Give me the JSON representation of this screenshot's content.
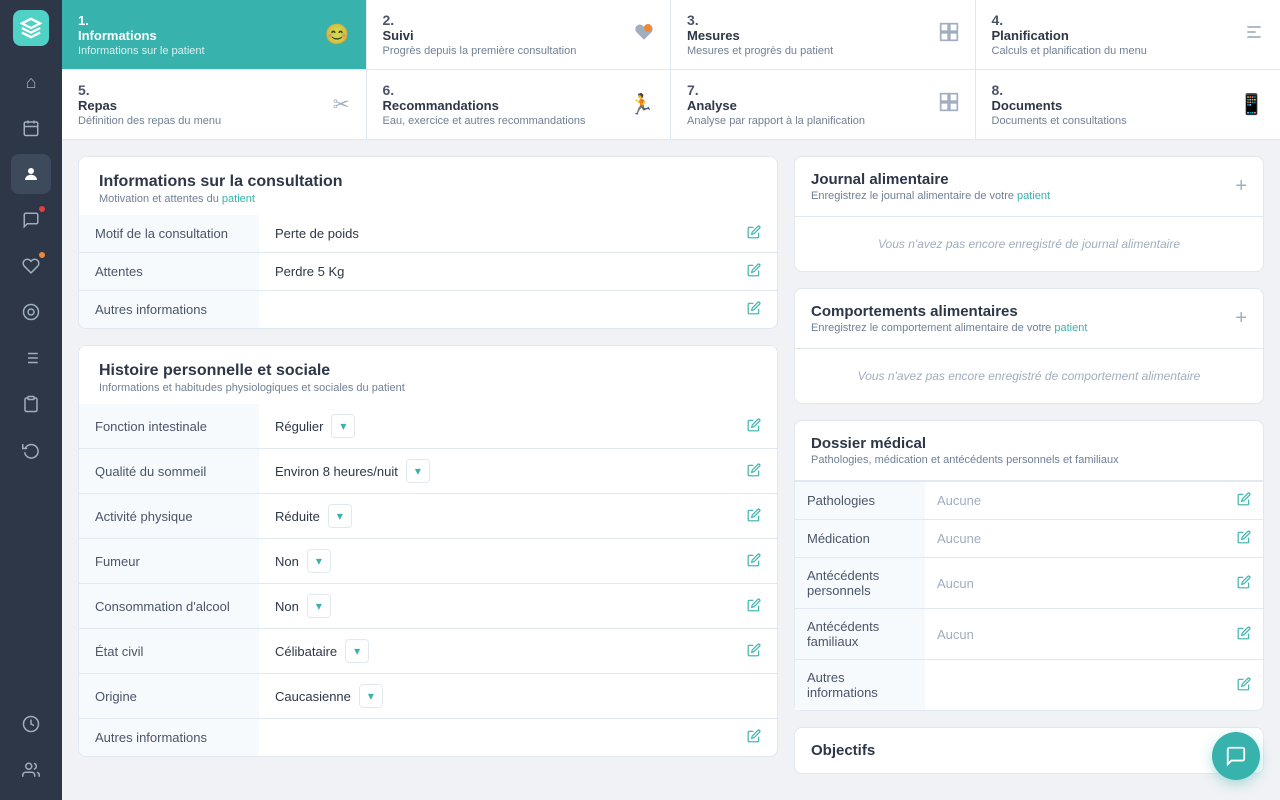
{
  "sidebar": {
    "logo": "N",
    "icons": [
      {
        "name": "home-icon",
        "symbol": "⌂",
        "active": false
      },
      {
        "name": "calendar-icon",
        "symbol": "▦",
        "active": false
      },
      {
        "name": "patients-icon",
        "symbol": "●",
        "active": true
      },
      {
        "name": "chat-icon",
        "symbol": "💬",
        "active": false,
        "badge": "red"
      },
      {
        "name": "heart-icon",
        "symbol": "♥",
        "active": false,
        "badge": "orange"
      },
      {
        "name": "nutrition-icon",
        "symbol": "◉",
        "active": false
      },
      {
        "name": "reports-icon",
        "symbol": "≡",
        "active": false
      },
      {
        "name": "clipboard-icon",
        "symbol": "📋",
        "active": false
      },
      {
        "name": "history-icon",
        "symbol": "↺",
        "active": false
      },
      {
        "name": "clock-icon",
        "symbol": "⏰",
        "active": false,
        "bottom": true
      },
      {
        "name": "group-icon",
        "symbol": "👥",
        "active": false,
        "bottom": true
      }
    ]
  },
  "nav_tabs_row1": [
    {
      "num": "1.",
      "title": "Informations",
      "subtitle": "Informations sur le patient",
      "icon": "😊",
      "active": true
    },
    {
      "num": "2.",
      "title": "Suivi",
      "subtitle": "Progrès depuis la première consultation",
      "icon": "♥",
      "active": false
    },
    {
      "num": "3.",
      "title": "Mesures",
      "subtitle": "Mesures et progrès du patient",
      "icon": "▦",
      "active": false
    },
    {
      "num": "4.",
      "title": "Planification",
      "subtitle": "Calculs et planification du menu",
      "icon": "⚙",
      "active": false
    }
  ],
  "nav_tabs_row2": [
    {
      "num": "5.",
      "title": "Repas",
      "subtitle": "Définition des repas du menu",
      "icon": "✂",
      "active": false
    },
    {
      "num": "6.",
      "title": "Recommandations",
      "subtitle": "Eau, exercice et autres recommandations",
      "icon": "🏃",
      "active": false
    },
    {
      "num": "7.",
      "title": "Analyse",
      "subtitle": "Analyse par rapport à la planification",
      "icon": "▦",
      "active": false
    },
    {
      "num": "8.",
      "title": "Documents",
      "subtitle": "Documents et consultations",
      "icon": "📱",
      "active": false
    }
  ],
  "consultation": {
    "title": "Informations sur la consultation",
    "subtitle_plain": "Motivation et attentes du ",
    "subtitle_teal": "patient",
    "rows": [
      {
        "label": "Motif de la consultation",
        "value": "Perte de poids"
      },
      {
        "label": "Attentes",
        "value": "Perdre 5 Kg"
      },
      {
        "label": "Autres informations",
        "value": ""
      }
    ]
  },
  "histoire": {
    "title": "Histoire personnelle et sociale",
    "subtitle": "Informations et habitudes physiologiques et sociales du patient",
    "rows": [
      {
        "label": "Fonction intestinale",
        "value": "Régulier",
        "type": "select"
      },
      {
        "label": "Qualité du sommeil",
        "value": "Environ 8 heures/nuit",
        "type": "select"
      },
      {
        "label": "Activité physique",
        "value": "Réduite",
        "type": "select"
      },
      {
        "label": "Fumeur",
        "value": "Non",
        "type": "select"
      },
      {
        "label": "Consommation d'alcool",
        "value": "Non",
        "type": "select"
      },
      {
        "label": "État civil",
        "value": "Célibataire",
        "type": "select"
      },
      {
        "label": "Origine",
        "value": "Caucasienne",
        "type": "select2"
      },
      {
        "label": "Autres informations",
        "value": "",
        "type": "edit"
      }
    ]
  },
  "journal": {
    "title": "Journal alimentaire",
    "subtitle_plain": "Enregistrez le journal alimentaire de votre ",
    "subtitle_teal": "patient",
    "empty_text": "Vous n'avez pas encore enregistré de journal alimentaire"
  },
  "comportements": {
    "title": "Comportements alimentaires",
    "subtitle_plain": "Enregistrez le comportement alimentaire de votre ",
    "subtitle_teal": "patient",
    "empty_text": "Vous n'avez pas encore enregistré de comportement alimentaire"
  },
  "dossier": {
    "title": "Dossier médical",
    "subtitle": "Pathologies, médication et antécédents personnels et familiaux",
    "rows": [
      {
        "label": "Pathologies",
        "value": "Aucune"
      },
      {
        "label": "Médication",
        "value": "Aucune"
      },
      {
        "label": "Antécédents personnels",
        "value": "Aucun"
      },
      {
        "label": "Antécédents familiaux",
        "value": "Aucun"
      },
      {
        "label": "Autres informations",
        "value": ""
      }
    ]
  },
  "objectifs": {
    "title": "Objectifs"
  }
}
